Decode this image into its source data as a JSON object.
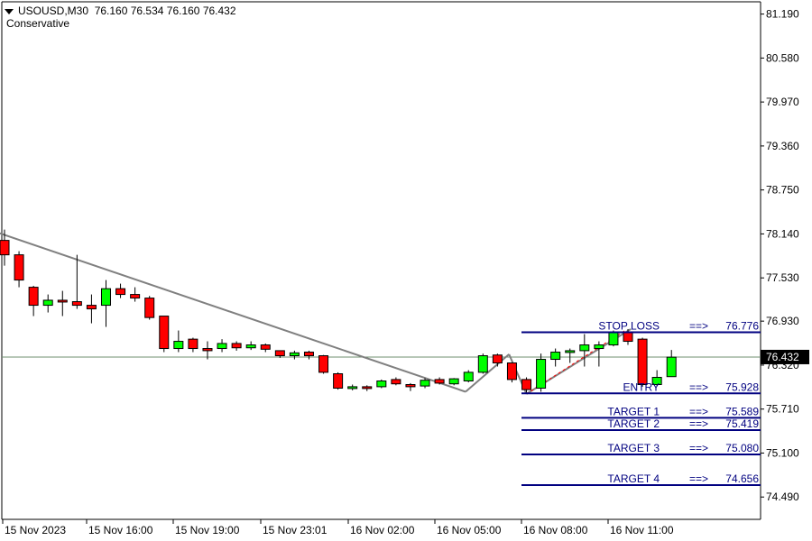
{
  "header": {
    "symbol_timeframe": "USOUSD,M30",
    "ohlc": "76.160 76.534 76.160 76.432",
    "indicator": "Conservative"
  },
  "colors": {
    "bull": "#00ff00",
    "bear": "#ff0000",
    "level_line": "#000080",
    "trend_line": "#808080",
    "price_tag_bg": "#000000"
  },
  "chart_data": {
    "type": "candlestick",
    "y_ticks": [
      "81.190",
      "80.580",
      "79.970",
      "79.360",
      "78.750",
      "78.140",
      "77.530",
      "76.930",
      "76.320",
      "75.710",
      "75.100",
      "74.490"
    ],
    "x_ticks": [
      "15 Nov 2023",
      "15 Nov 16:00",
      "15 Nov 19:00",
      "15 Nov 23:01",
      "16 Nov 02:00",
      "16 Nov 05:00",
      "16 Nov 08:00",
      "16 Nov 11:00"
    ],
    "ylim": [
      74.18,
      81.36
    ],
    "current_price": "76.432",
    "candles": [
      {
        "o": 78.05,
        "h": 78.2,
        "l": 77.7,
        "c": 77.85
      },
      {
        "o": 77.85,
        "h": 77.9,
        "l": 77.4,
        "c": 77.5
      },
      {
        "o": 77.4,
        "h": 77.42,
        "l": 77.0,
        "c": 77.15
      },
      {
        "o": 77.15,
        "h": 77.3,
        "l": 77.05,
        "c": 77.22
      },
      {
        "o": 77.22,
        "h": 77.35,
        "l": 77.0,
        "c": 77.2
      },
      {
        "o": 77.2,
        "h": 77.85,
        "l": 77.1,
        "c": 77.15
      },
      {
        "o": 77.15,
        "h": 77.3,
        "l": 76.9,
        "c": 77.1
      },
      {
        "o": 77.15,
        "h": 77.5,
        "l": 76.85,
        "c": 77.38
      },
      {
        "o": 77.38,
        "h": 77.45,
        "l": 77.25,
        "c": 77.3
      },
      {
        "o": 77.3,
        "h": 77.4,
        "l": 77.2,
        "c": 77.25
      },
      {
        "o": 77.25,
        "h": 77.28,
        "l": 76.95,
        "c": 76.98
      },
      {
        "o": 77.0,
        "h": 77.0,
        "l": 76.5,
        "c": 76.55
      },
      {
        "o": 76.55,
        "h": 76.8,
        "l": 76.5,
        "c": 76.65
      },
      {
        "o": 76.68,
        "h": 76.7,
        "l": 76.5,
        "c": 76.55
      },
      {
        "o": 76.55,
        "h": 76.65,
        "l": 76.4,
        "c": 76.52
      },
      {
        "o": 76.55,
        "h": 76.68,
        "l": 76.5,
        "c": 76.62
      },
      {
        "o": 76.62,
        "h": 76.65,
        "l": 76.52,
        "c": 76.56
      },
      {
        "o": 76.56,
        "h": 76.65,
        "l": 76.53,
        "c": 76.6
      },
      {
        "o": 76.6,
        "h": 76.62,
        "l": 76.5,
        "c": 76.54
      },
      {
        "o": 76.52,
        "h": 76.52,
        "l": 76.42,
        "c": 76.45
      },
      {
        "o": 76.45,
        "h": 76.52,
        "l": 76.4,
        "c": 76.49
      },
      {
        "o": 76.5,
        "h": 76.52,
        "l": 76.4,
        "c": 76.45
      },
      {
        "o": 76.45,
        "h": 76.46,
        "l": 76.2,
        "c": 76.22
      },
      {
        "o": 76.2,
        "h": 76.22,
        "l": 75.98,
        "c": 76.0
      },
      {
        "o": 76.0,
        "h": 76.05,
        "l": 75.97,
        "c": 76.02
      },
      {
        "o": 76.02,
        "h": 76.04,
        "l": 75.96,
        "c": 76.01
      },
      {
        "o": 76.02,
        "h": 76.12,
        "l": 76.0,
        "c": 76.1
      },
      {
        "o": 76.12,
        "h": 76.15,
        "l": 76.04,
        "c": 76.06
      },
      {
        "o": 76.05,
        "h": 76.07,
        "l": 75.96,
        "c": 76.02
      },
      {
        "o": 76.03,
        "h": 76.14,
        "l": 76.0,
        "c": 76.11
      },
      {
        "o": 76.12,
        "h": 76.15,
        "l": 76.05,
        "c": 76.07
      },
      {
        "o": 76.06,
        "h": 76.14,
        "l": 76.04,
        "c": 76.13
      },
      {
        "o": 76.1,
        "h": 76.25,
        "l": 76.08,
        "c": 76.22
      },
      {
        "o": 76.22,
        "h": 76.48,
        "l": 76.2,
        "c": 76.45
      },
      {
        "o": 76.46,
        "h": 76.48,
        "l": 76.3,
        "c": 76.35
      },
      {
        "o": 76.35,
        "h": 76.36,
        "l": 76.08,
        "c": 76.12
      },
      {
        "o": 76.12,
        "h": 76.15,
        "l": 75.94,
        "c": 75.98
      },
      {
        "o": 76.0,
        "h": 76.48,
        "l": 75.95,
        "c": 76.4
      },
      {
        "o": 76.4,
        "h": 76.55,
        "l": 76.3,
        "c": 76.5
      },
      {
        "o": 76.5,
        "h": 76.55,
        "l": 76.35,
        "c": 76.52
      },
      {
        "o": 76.52,
        "h": 76.75,
        "l": 76.3,
        "c": 76.6
      },
      {
        "o": 76.55,
        "h": 76.65,
        "l": 76.3,
        "c": 76.6
      },
      {
        "o": 76.6,
        "h": 76.8,
        "l": 76.58,
        "c": 76.78
      },
      {
        "o": 76.78,
        "h": 76.82,
        "l": 76.6,
        "c": 76.65
      },
      {
        "o": 76.68,
        "h": 76.7,
        "l": 76.02,
        "c": 76.05
      },
      {
        "o": 76.05,
        "h": 76.25,
        "l": 76.03,
        "c": 76.15
      },
      {
        "o": 76.16,
        "h": 76.53,
        "l": 76.16,
        "c": 76.43
      }
    ],
    "trend_lines": [
      {
        "from": {
          "i": -0.5,
          "p": 78.16
        },
        "to": {
          "i": 31.8,
          "p": 75.95
        }
      },
      {
        "from": {
          "i": 31.8,
          "p": 75.95
        },
        "to": {
          "i": 34.8,
          "p": 76.47
        }
      },
      {
        "from": {
          "i": 34.8,
          "p": 76.47
        },
        "to": {
          "i": 36.0,
          "p": 75.92
        }
      },
      {
        "from": {
          "i": 36.0,
          "p": 75.92
        },
        "to": {
          "i": 43.2,
          "p": 76.82
        }
      }
    ],
    "dashed_line": {
      "from": {
        "i": 36.0,
        "p": 75.92
      },
      "to": {
        "i": 42.8,
        "p": 76.8
      }
    },
    "levels": [
      {
        "label": "STOP LOSS",
        "arrow": "==>",
        "value": "76.776"
      },
      {
        "label": "ENTRY",
        "arrow": "==>",
        "value": "75.928"
      },
      {
        "label": "TARGET 1",
        "arrow": "==>",
        "value": "75.589"
      },
      {
        "label": "TARGET 2",
        "arrow": "==>",
        "value": "75.419"
      },
      {
        "label": "TARGET 3",
        "arrow": "==>",
        "value": "75.080"
      },
      {
        "label": "TARGET 4",
        "arrow": "==>",
        "value": "74.656"
      }
    ]
  }
}
